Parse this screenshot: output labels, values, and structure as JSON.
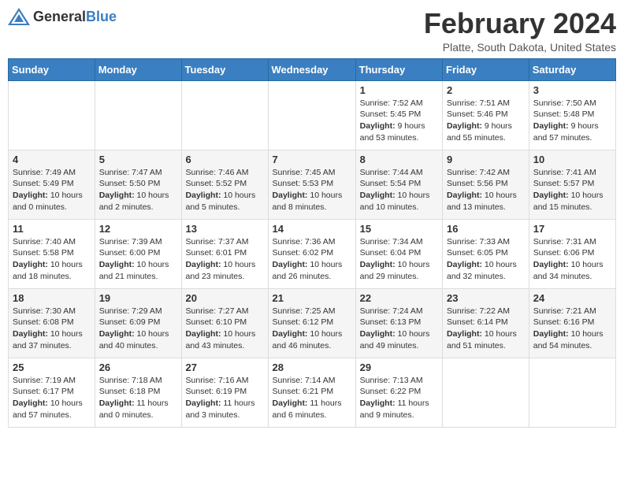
{
  "header": {
    "logo_general": "General",
    "logo_blue": "Blue",
    "month": "February 2024",
    "location": "Platte, South Dakota, United States"
  },
  "days_of_week": [
    "Sunday",
    "Monday",
    "Tuesday",
    "Wednesday",
    "Thursday",
    "Friday",
    "Saturday"
  ],
  "weeks": [
    [
      {
        "day": "",
        "content": ""
      },
      {
        "day": "",
        "content": ""
      },
      {
        "day": "",
        "content": ""
      },
      {
        "day": "",
        "content": ""
      },
      {
        "day": "1",
        "content": "Sunrise: 7:52 AM\nSunset: 5:45 PM\nDaylight: 9 hours and 53 minutes."
      },
      {
        "day": "2",
        "content": "Sunrise: 7:51 AM\nSunset: 5:46 PM\nDaylight: 9 hours and 55 minutes."
      },
      {
        "day": "3",
        "content": "Sunrise: 7:50 AM\nSunset: 5:48 PM\nDaylight: 9 hours and 57 minutes."
      }
    ],
    [
      {
        "day": "4",
        "content": "Sunrise: 7:49 AM\nSunset: 5:49 PM\nDaylight: 10 hours and 0 minutes."
      },
      {
        "day": "5",
        "content": "Sunrise: 7:47 AM\nSunset: 5:50 PM\nDaylight: 10 hours and 2 minutes."
      },
      {
        "day": "6",
        "content": "Sunrise: 7:46 AM\nSunset: 5:52 PM\nDaylight: 10 hours and 5 minutes."
      },
      {
        "day": "7",
        "content": "Sunrise: 7:45 AM\nSunset: 5:53 PM\nDaylight: 10 hours and 8 minutes."
      },
      {
        "day": "8",
        "content": "Sunrise: 7:44 AM\nSunset: 5:54 PM\nDaylight: 10 hours and 10 minutes."
      },
      {
        "day": "9",
        "content": "Sunrise: 7:42 AM\nSunset: 5:56 PM\nDaylight: 10 hours and 13 minutes."
      },
      {
        "day": "10",
        "content": "Sunrise: 7:41 AM\nSunset: 5:57 PM\nDaylight: 10 hours and 15 minutes."
      }
    ],
    [
      {
        "day": "11",
        "content": "Sunrise: 7:40 AM\nSunset: 5:58 PM\nDaylight: 10 hours and 18 minutes."
      },
      {
        "day": "12",
        "content": "Sunrise: 7:39 AM\nSunset: 6:00 PM\nDaylight: 10 hours and 21 minutes."
      },
      {
        "day": "13",
        "content": "Sunrise: 7:37 AM\nSunset: 6:01 PM\nDaylight: 10 hours and 23 minutes."
      },
      {
        "day": "14",
        "content": "Sunrise: 7:36 AM\nSunset: 6:02 PM\nDaylight: 10 hours and 26 minutes."
      },
      {
        "day": "15",
        "content": "Sunrise: 7:34 AM\nSunset: 6:04 PM\nDaylight: 10 hours and 29 minutes."
      },
      {
        "day": "16",
        "content": "Sunrise: 7:33 AM\nSunset: 6:05 PM\nDaylight: 10 hours and 32 minutes."
      },
      {
        "day": "17",
        "content": "Sunrise: 7:31 AM\nSunset: 6:06 PM\nDaylight: 10 hours and 34 minutes."
      }
    ],
    [
      {
        "day": "18",
        "content": "Sunrise: 7:30 AM\nSunset: 6:08 PM\nDaylight: 10 hours and 37 minutes."
      },
      {
        "day": "19",
        "content": "Sunrise: 7:29 AM\nSunset: 6:09 PM\nDaylight: 10 hours and 40 minutes."
      },
      {
        "day": "20",
        "content": "Sunrise: 7:27 AM\nSunset: 6:10 PM\nDaylight: 10 hours and 43 minutes."
      },
      {
        "day": "21",
        "content": "Sunrise: 7:25 AM\nSunset: 6:12 PM\nDaylight: 10 hours and 46 minutes."
      },
      {
        "day": "22",
        "content": "Sunrise: 7:24 AM\nSunset: 6:13 PM\nDaylight: 10 hours and 49 minutes."
      },
      {
        "day": "23",
        "content": "Sunrise: 7:22 AM\nSunset: 6:14 PM\nDaylight: 10 hours and 51 minutes."
      },
      {
        "day": "24",
        "content": "Sunrise: 7:21 AM\nSunset: 6:16 PM\nDaylight: 10 hours and 54 minutes."
      }
    ],
    [
      {
        "day": "25",
        "content": "Sunrise: 7:19 AM\nSunset: 6:17 PM\nDaylight: 10 hours and 57 minutes."
      },
      {
        "day": "26",
        "content": "Sunrise: 7:18 AM\nSunset: 6:18 PM\nDaylight: 11 hours and 0 minutes."
      },
      {
        "day": "27",
        "content": "Sunrise: 7:16 AM\nSunset: 6:19 PM\nDaylight: 11 hours and 3 minutes."
      },
      {
        "day": "28",
        "content": "Sunrise: 7:14 AM\nSunset: 6:21 PM\nDaylight: 11 hours and 6 minutes."
      },
      {
        "day": "29",
        "content": "Sunrise: 7:13 AM\nSunset: 6:22 PM\nDaylight: 11 hours and 9 minutes."
      },
      {
        "day": "",
        "content": ""
      },
      {
        "day": "",
        "content": ""
      }
    ]
  ]
}
